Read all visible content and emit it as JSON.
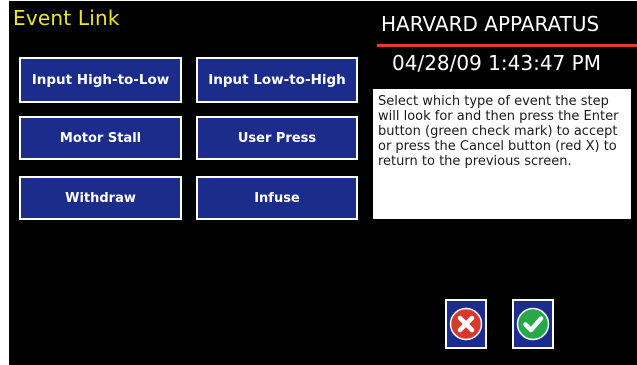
{
  "screen": {
    "title": "Event Link",
    "brand": "HARVARD APPARATUS",
    "datetime": "04/28/09 1:43:47 PM"
  },
  "event_buttons": {
    "input_high_to_low": "Input High-to-Low",
    "input_low_to_high": "Input Low-to-High",
    "motor_stall": "Motor Stall",
    "user_press": "User Press",
    "withdraw": "Withdraw",
    "infuse": "Infuse"
  },
  "help": {
    "text": "Select which type of event the step will look for and then press the Enter button (green check mark) to accept or press the Cancel button (red X) to return to the previous screen."
  },
  "actions": {
    "cancel_icon": "red-x-icon",
    "enter_icon": "green-check-icon"
  },
  "colors": {
    "background": "#000000",
    "title": "#ece52a",
    "button_fill": "#1b2c8d",
    "brand_rule": "#e43a30",
    "cancel_red": "#d63a2f",
    "enter_green": "#27a84a"
  }
}
